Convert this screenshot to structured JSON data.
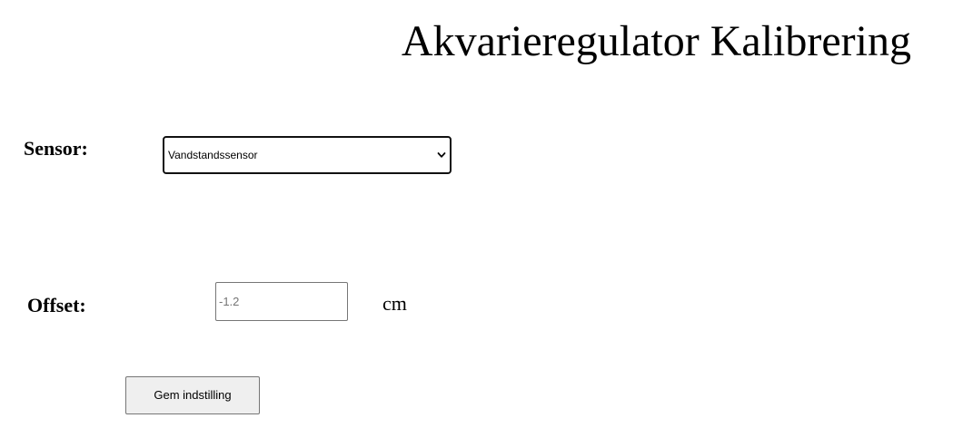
{
  "header": {
    "title": "Akvarieregulator Kalibrering"
  },
  "form": {
    "sensor": {
      "label": "Sensor:",
      "selected": "Vandstandssensor",
      "chevron_icon": "chevron-down-icon"
    },
    "offset": {
      "label": "Offset:",
      "placeholder": "-1.2",
      "value": "",
      "unit": "cm"
    },
    "save_button": {
      "label": "Gem indstilling"
    }
  }
}
